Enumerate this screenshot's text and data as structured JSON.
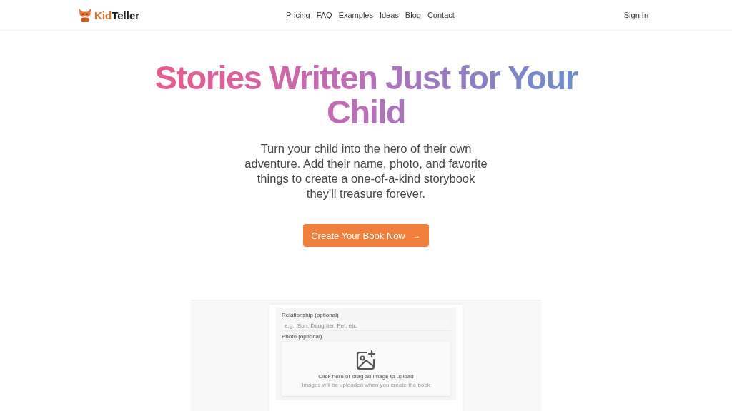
{
  "header": {
    "brand_prefix": "Kid",
    "brand_suffix": "Teller",
    "nav": [
      "Pricing",
      "FAQ",
      "Examples",
      "Ideas",
      "Blog",
      "Contact"
    ],
    "sign_in": "Sign In"
  },
  "hero": {
    "title": "Stories Written Just for Your Child",
    "subtitle": "Turn your child into the hero of their own adventure. Add their name, photo, and favorite things to create a one-of-a-kind storybook they'll treasure forever.",
    "cta": "Create Your Book Now",
    "cta_icon": "→"
  },
  "preview": {
    "relationship_label": "Relationship (optional)",
    "relationship_placeholder": "e.g., Son, Daughter, Pet, etc.",
    "photo_label": "Photo (optional)",
    "upload_text": "Click here or drag an image to upload",
    "upload_note": "Images will be uploaded when you create the book"
  }
}
